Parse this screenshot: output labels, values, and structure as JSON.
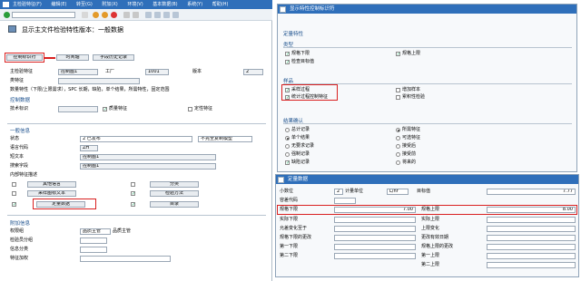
{
  "left": {
    "menu": [
      "主检验特征(F)",
      "编辑(E)",
      "转至(G)",
      "附加(X)",
      "环境(V)",
      "基本数据(B)",
      "系统(Y)",
      "帮助(H)"
    ],
    "page_title": "显示主文件检验特性版本：一般数据",
    "tabs": {
      "control": "控制标识符",
      "timeline": "时间轴",
      "history": "字段历史记录"
    },
    "header": {
      "master_char_label": "主检验特征",
      "master_char_value": "控制图1",
      "plant_label": "工厂",
      "plant_value": "1001",
      "version_label": "版本",
      "version_value": "2",
      "class_char_label": "类特征",
      "data_prefix": "数量特性（下限/上限需求），SPC 长期，缺陷，单个结果，所需特性，固定范围"
    },
    "control_data": {
      "section": "控制数据",
      "tech_id_label": "技术标识",
      "qual_char": "质量特征",
      "quant_char": "定量特征",
      "attr_char": "定性特征"
    },
    "general": {
      "section": "一般信息",
      "status_label": "状态",
      "status_value": "2 已发布",
      "incomplete_copy": "不完全复制模型",
      "lang_label": "语言代码",
      "lang_value": "ZH",
      "short_text_label": "短文本",
      "short_text_value": "控制图1",
      "search_field_label": "搜索字段",
      "search_field_value": "控制图1",
      "internal_desc": "内部特征描述",
      "other_lang": "其他语言",
      "classify": "分类",
      "sample_text": "采样图标文本",
      "inspect_method": "检验方法",
      "quant_data": "定量数据",
      "catalog": "目录"
    },
    "extra": {
      "section": "附加信息",
      "author_label": "权限组",
      "author_value": "品质主管",
      "author_desc": "品质主管",
      "insp_unit_label": "检验员分组",
      "sort_label": "信息分类",
      "field_name_label": "特征加权"
    }
  },
  "right_top": {
    "title": "显示特性控制标识符",
    "quant_section": "定量特性",
    "type_section": "类型",
    "type_items": [
      "规格下限",
      "规格上限",
      "检查目标值"
    ],
    "sample_section": "样品",
    "sample_items": [
      "采样过程",
      "统计过程控制特征",
      "增加样本",
      "累积性检验"
    ],
    "results_section": "结果确认",
    "results_left": [
      "总计记录",
      "单个结果",
      "无要求记录",
      "强制记录",
      "缺陷记录"
    ],
    "results_right": [
      "所需特征",
      "可选特征",
      "接受后",
      "接受前",
      "将来的"
    ]
  },
  "right_bottom": {
    "title": "定量数据",
    "decimals_label": "小数位",
    "decimals_value": "2",
    "unit_label": "计量单位",
    "unit_value": "L/hr",
    "target_label": "目标值",
    "target_value": "7.77",
    "tol_key_label": "容差代码",
    "lower_spec_label": "规格下限",
    "lower_spec_value": "7.00",
    "upper_spec_label": "规格上限",
    "upper_spec_value": "8.00",
    "rows_left": [
      "实际下限",
      "允差变化至于",
      "规格下限的更改",
      "第一下限",
      "第二下限"
    ],
    "rows_right": [
      "实际上限",
      "上限变化",
      "更改有效日期",
      "规格上限的更改",
      "第一上限",
      "第二上限"
    ]
  }
}
